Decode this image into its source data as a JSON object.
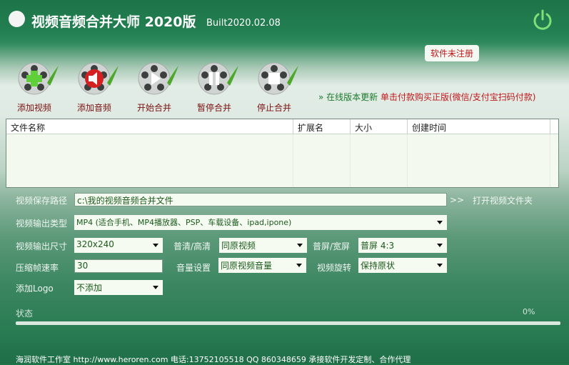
{
  "header": {
    "title": "视频音频合并大师 2020版",
    "built": "Built2020.02.08",
    "reg_badge": "软件未注册"
  },
  "toolbar": [
    {
      "label": "添加视频",
      "icon": "add-video-icon"
    },
    {
      "label": "添加音频",
      "icon": "add-audio-icon"
    },
    {
      "label": "开始合并",
      "icon": "play-icon"
    },
    {
      "label": "暂停合并",
      "icon": "pause-icon"
    },
    {
      "label": "停止合并",
      "icon": "stop-icon"
    }
  ],
  "links": {
    "update": "» 在线版本更新",
    "buy": "单击付款购买正版(微信/支付宝扫码付款)"
  },
  "table": {
    "columns": [
      "文件名称",
      "扩展名",
      "大小",
      "创建时间"
    ],
    "rows": []
  },
  "form": {
    "path_label": "视频保存路径",
    "path_value": "c:\\我的视频音频合并文件",
    "open_arrow": ">>",
    "open_folder": "打开视频文件夹",
    "type_label": "视频输出类型",
    "type_value": "MP4 (适合手机、MP4播放器、PSP、车载设备、ipad,ipone)",
    "size_label": "视频输出尺寸",
    "size_value": "320x240",
    "quality_label": "普清/高清",
    "quality_value": "同原视频",
    "aspect_label": "普屏/宽屏",
    "aspect_value": "普屏 4:3",
    "fps_label": "压缩帧速率",
    "fps_value": "30",
    "volume_label": "音量设置",
    "volume_value": "同原视频音量",
    "rotate_label": "视频旋转",
    "rotate_value": "保持原状",
    "logo_label": "添加Logo",
    "logo_value": "不添加"
  },
  "status": {
    "label": "状态",
    "percent_text": "0%",
    "progress": 0
  },
  "footer": {
    "text": "海润软件工作室 http://www.heroren.com  电话:13752105518  QQ 860348659 承接软件开发定制、合作代理"
  }
}
